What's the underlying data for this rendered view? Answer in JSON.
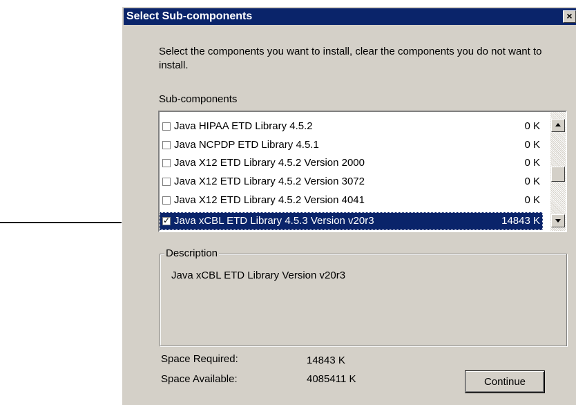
{
  "window": {
    "title": "Select Sub-components",
    "close_glyph": "×"
  },
  "instructions": "Select the components you want to install, clear the components you do not want to install.",
  "subcomponents": {
    "label": "Sub-components",
    "items": [
      {
        "label": "Java HIPAA ETD Library 4.5.2",
        "size": "0 K",
        "checked": false,
        "selected": false
      },
      {
        "label": "Java NCPDP ETD Library 4.5.1",
        "size": "0 K",
        "checked": false,
        "selected": false
      },
      {
        "label": "Java X12 ETD Library 4.5.2 Version 2000",
        "size": "0 K",
        "checked": false,
        "selected": false
      },
      {
        "label": "Java X12 ETD Library 4.5.2 Version 3072",
        "size": "0 K",
        "checked": false,
        "selected": false
      },
      {
        "label": "Java X12 ETD Library 4.5.2 Version 4041",
        "size": "0 K",
        "checked": false,
        "selected": false
      },
      {
        "label": "Java xCBL ETD Library 4.5.3 Version v20r3",
        "size": "14843 K",
        "checked": true,
        "selected": true
      }
    ]
  },
  "description": {
    "label": "Description",
    "text": "Java xCBL ETD Library Version v20r3"
  },
  "space": {
    "required_label": "Space Required:",
    "required_value": "14843 K",
    "available_label": "Space Available:",
    "available_value": "4085411 K"
  },
  "buttons": {
    "continue_label": "Continue"
  },
  "icons": {
    "checkbox_check": "✓",
    "scroll_up": "triangle-up-icon",
    "scroll_down": "triangle-down-icon",
    "annotation": "arrow-right-icon"
  },
  "colors": {
    "titlebar": "#0a246a",
    "selection": "#0a246a",
    "dialog_face": "#d4d0c8"
  }
}
